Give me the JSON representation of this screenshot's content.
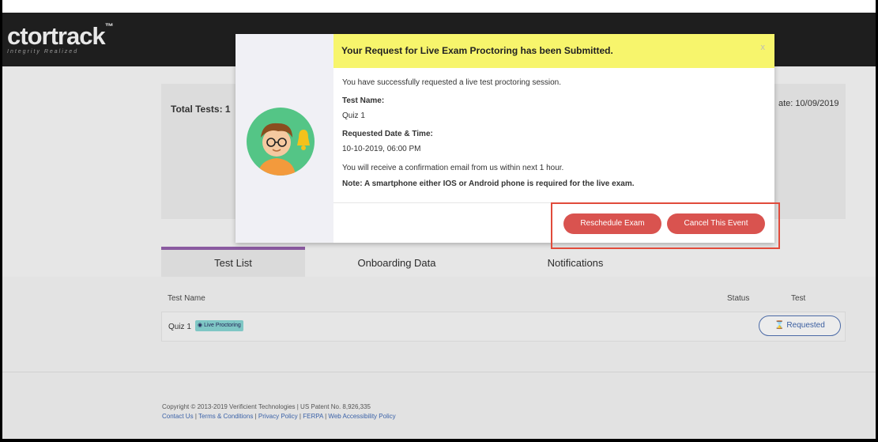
{
  "header": {
    "logo_text": "ctortrack",
    "logo_tm": "™",
    "tagline": "Integrity Realized"
  },
  "summary": {
    "total_tests_label": "Total Tests: 1",
    "date_label": "ate: 10/09/2019"
  },
  "tabs": [
    {
      "label": "Test List"
    },
    {
      "label": "Onboarding Data"
    },
    {
      "label": "Notifications"
    }
  ],
  "table": {
    "headers": {
      "test_name": "Test Name",
      "status": "Status",
      "test": "Test"
    },
    "rows": [
      {
        "name": "Quiz 1",
        "badge": "Live Proctoring",
        "action": "Requested"
      }
    ]
  },
  "footer": {
    "copyright": "Copyright © 2013-2019 Verificient Technologies | US Patent No. 8,926,335",
    "links": [
      "Contact Us",
      "Terms & Conditions",
      "Privacy Policy",
      "FERPA",
      "Web Accessibility Policy"
    ]
  },
  "modal": {
    "title": "Your Request for Live Exam Proctoring has been Submitted.",
    "close": "x",
    "intro": "You have successfully requested a live test proctoring session.",
    "test_name_label": "Test Name:",
    "test_name_value": "Quiz 1",
    "datetime_label": "Requested Date & Time:",
    "datetime_value": "10-10-2019, 06:00 PM",
    "confirmation": "You will receive a confirmation email from us within next 1 hour.",
    "note": "Note: A smartphone either IOS or Android phone is required for the live exam.",
    "reschedule_label": "Reschedule Exam",
    "cancel_label": "Cancel This Event"
  },
  "colors": {
    "accent": "#d9534f",
    "modal_header": "#f7f56c",
    "tab_active": "#8a5aa0",
    "link": "#3b62a8"
  }
}
